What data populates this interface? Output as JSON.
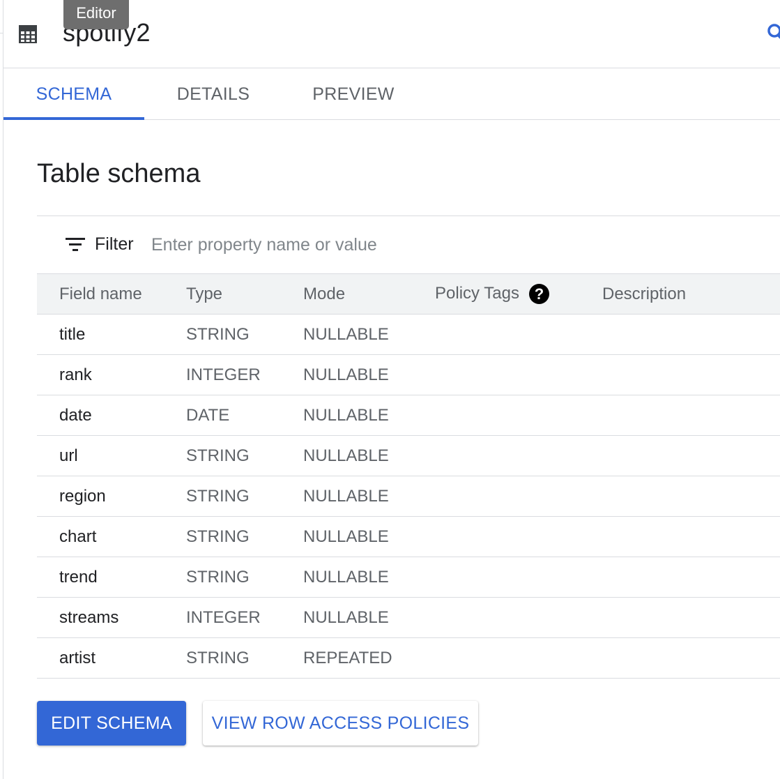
{
  "header": {
    "title": "spotify2",
    "tooltip": "Editor",
    "table_icon": "table-icon",
    "search_icon": "search-icon"
  },
  "tabs": [
    {
      "label": "SCHEMA",
      "active": true
    },
    {
      "label": "DETAILS",
      "active": false
    },
    {
      "label": "PREVIEW",
      "active": false
    }
  ],
  "schema": {
    "title": "Table schema",
    "filter": {
      "label": "Filter",
      "placeholder": "Enter property name or value",
      "icon": "filter-icon"
    },
    "columns": [
      "Field name",
      "Type",
      "Mode",
      "Policy Tags",
      "Description"
    ],
    "help_icon_text": "?",
    "rows": [
      {
        "name": "title",
        "type": "STRING",
        "mode": "NULLABLE",
        "policy_tags": "",
        "description": ""
      },
      {
        "name": "rank",
        "type": "INTEGER",
        "mode": "NULLABLE",
        "policy_tags": "",
        "description": ""
      },
      {
        "name": "date",
        "type": "DATE",
        "mode": "NULLABLE",
        "policy_tags": "",
        "description": ""
      },
      {
        "name": "url",
        "type": "STRING",
        "mode": "NULLABLE",
        "policy_tags": "",
        "description": ""
      },
      {
        "name": "region",
        "type": "STRING",
        "mode": "NULLABLE",
        "policy_tags": "",
        "description": ""
      },
      {
        "name": "chart",
        "type": "STRING",
        "mode": "NULLABLE",
        "policy_tags": "",
        "description": ""
      },
      {
        "name": "trend",
        "type": "STRING",
        "mode": "NULLABLE",
        "policy_tags": "",
        "description": ""
      },
      {
        "name": "streams",
        "type": "INTEGER",
        "mode": "NULLABLE",
        "policy_tags": "",
        "description": ""
      },
      {
        "name": "artist",
        "type": "STRING",
        "mode": "REPEATED",
        "policy_tags": "",
        "description": ""
      }
    ]
  },
  "buttons": {
    "edit_schema": "EDIT SCHEMA",
    "view_row_access_policies": "VIEW ROW ACCESS POLICIES"
  },
  "colors": {
    "accent": "#3367d6",
    "text_primary": "#202124",
    "text_secondary": "#5f6368",
    "header_row_bg": "#f1f3f4",
    "tooltip_bg": "#6e6e6e"
  }
}
